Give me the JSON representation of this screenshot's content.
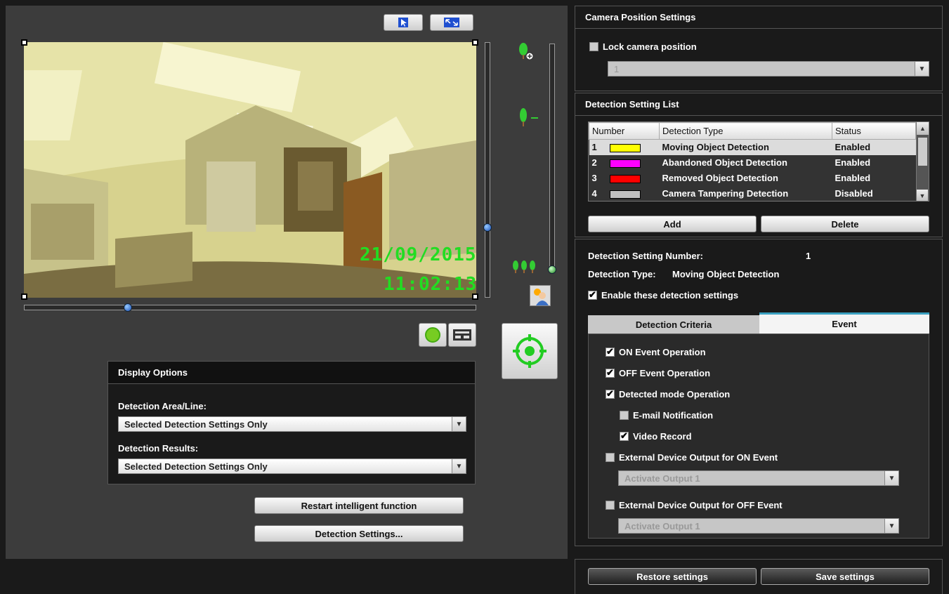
{
  "video": {
    "date": "21/09/2015",
    "time": "11:02:13"
  },
  "display_options": {
    "title": "Display Options",
    "area_label": "Detection Area/Line:",
    "area_value": "Selected Detection Settings Only",
    "results_label": "Detection Results:",
    "results_value": "Selected Detection Settings Only"
  },
  "buttons": {
    "restart": "Restart intelligent function",
    "detection_settings": "Detection Settings...",
    "add": "Add",
    "delete": "Delete",
    "restore": "Restore settings",
    "save": "Save settings"
  },
  "camera_position": {
    "title": "Camera Position Settings",
    "lock_label": "Lock camera position",
    "preset_value": "1"
  },
  "detection_list": {
    "title": "Detection Setting List",
    "headers": {
      "number": "Number",
      "type": "Detection Type",
      "status": "Status"
    },
    "rows": [
      {
        "number": "1",
        "color": "#ffff00",
        "type": "Moving Object Detection",
        "status": "Enabled"
      },
      {
        "number": "2",
        "color": "#ff00ff",
        "type": "Abandoned Object Detection",
        "status": "Enabled"
      },
      {
        "number": "3",
        "color": "#ff0000",
        "type": "Removed Object Detection",
        "status": "Enabled"
      },
      {
        "number": "4",
        "color": "#c0c0c0",
        "type": "Camera Tampering Detection",
        "status": "Disabled"
      }
    ]
  },
  "detail": {
    "number_label": "Detection Setting Number:",
    "number_value": "1",
    "type_label": "Detection Type:",
    "type_value": "Moving Object Detection",
    "enable_label": "Enable these detection settings"
  },
  "tabs": {
    "criteria": "Detection Criteria",
    "event": "Event"
  },
  "event": {
    "on_op": "ON Event Operation",
    "off_op": "OFF Event Operation",
    "detected_op": "Detected mode Operation",
    "email": "E-mail Notification",
    "video_record": "Video Record",
    "ext_on": "External Device Output for ON Event",
    "ext_on_value": "Activate Output 1",
    "ext_off": "External Device Output for OFF Event",
    "ext_off_value": "Activate Output 1"
  },
  "icons": {
    "pointer": "cursor-arrow-icon",
    "fit": "resize-icon",
    "zoom_in": "tree-zoom-in-icon",
    "zoom_out": "tree-zoom-out-icon",
    "wide": "trees-wide-icon",
    "brightness": "person-brightness-icon",
    "record": "green-circle-icon",
    "keyboard": "keyboard-icon",
    "target": "crosshair-target-icon"
  }
}
